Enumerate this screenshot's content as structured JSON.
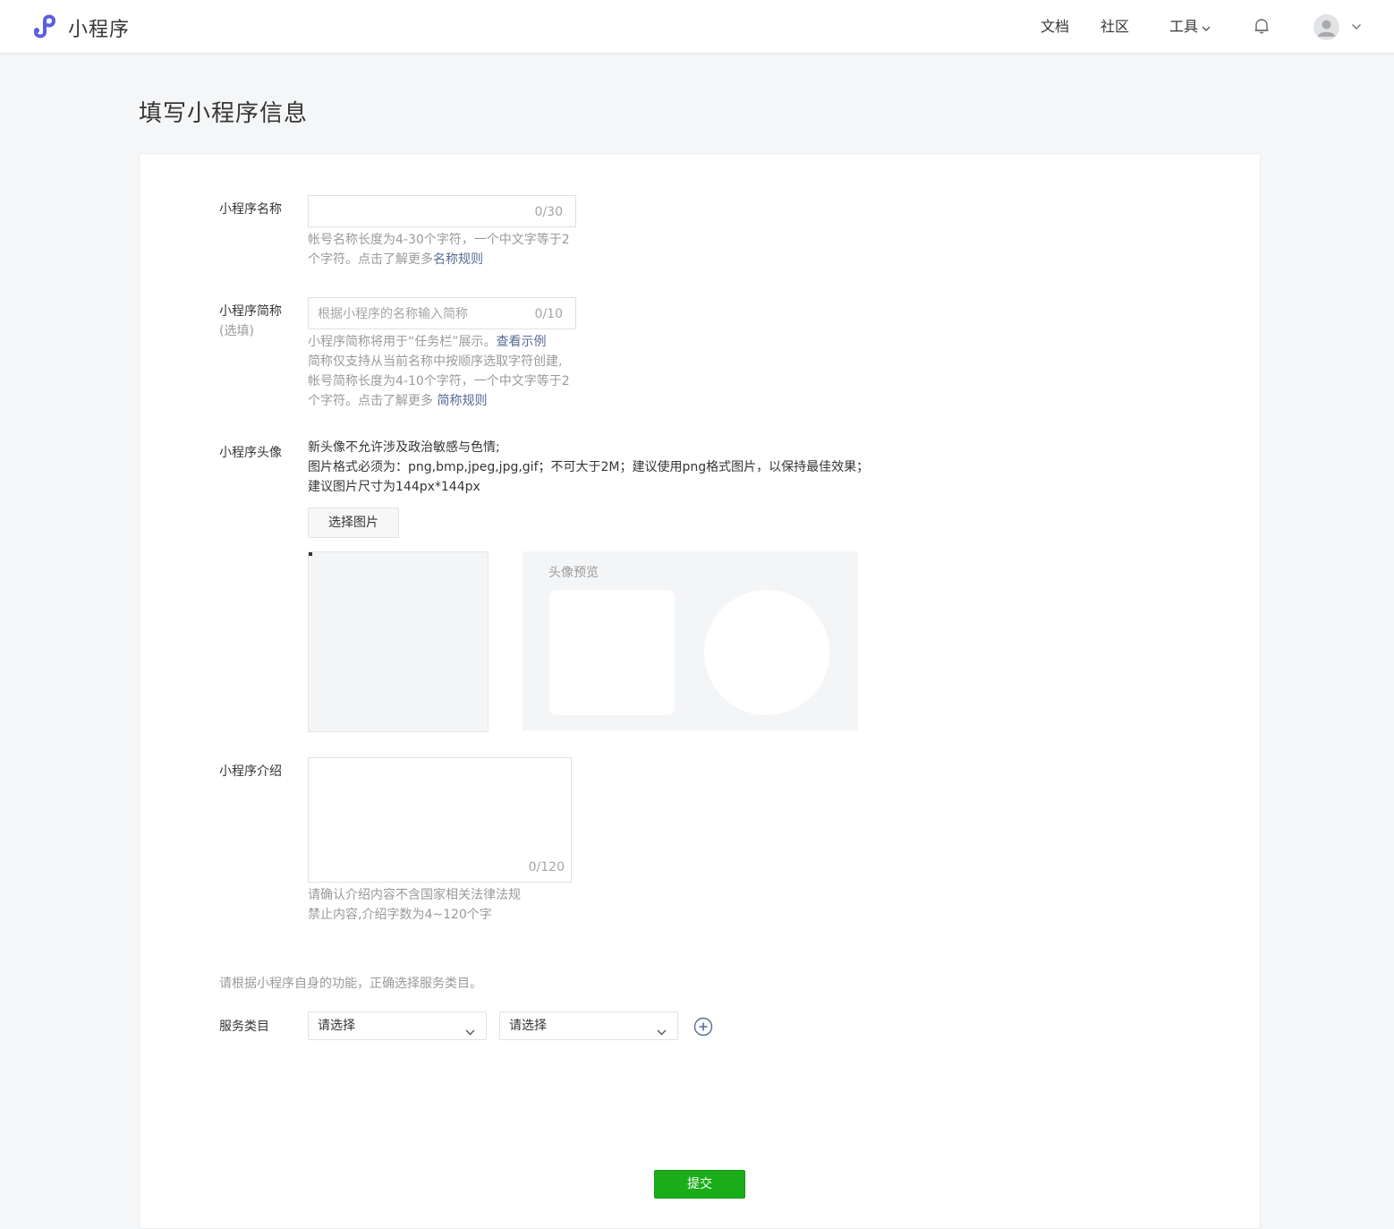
{
  "header": {
    "app_name": "小程序",
    "logo_icon": "mini-program-logo-icon",
    "nav": {
      "docs": "文档",
      "community": "社区",
      "tools": "工具"
    },
    "bell_icon": "bell-icon",
    "avatar_icon": "user-avatar-icon"
  },
  "page": {
    "title": "填写小程序信息"
  },
  "form": {
    "name": {
      "label": "小程序名称",
      "value": "",
      "counter": "0/30",
      "hint_text": "帐号名称长度为4-30个字符，一个中文字等于2个字符。点击了解更多",
      "hint_link": "名称规则"
    },
    "short_name": {
      "label": "小程序简称",
      "optional": "(选填)",
      "placeholder": "根据小程序的名称输入简称",
      "counter": "0/10",
      "hint_line1": "小程序简称将用于“任务栏”展示。",
      "hint_line1_link": "查看示例",
      "hint_line2": "简称仅支持从当前名称中按顺序选取字符创建,",
      "hint_line3": "帐号简称长度为4-10个字符，一个中文字等于2",
      "hint_line4": "个字符。点击了解更多 ",
      "hint_link": "简称规则"
    },
    "avatar": {
      "label": "小程序头像",
      "rule_line1": "新头像不允许涉及政治敏感与色情;",
      "rule_line2": "图片格式必须为：png,bmp,jpeg,jpg,gif；不可大于2M；建议使用png格式图片，以保持最佳效果；",
      "rule_line3": "建议图片尺寸为144px*144px",
      "choose_button": "选择图片",
      "preview_title": "头像预览"
    },
    "intro": {
      "label": "小程序介绍",
      "value": "",
      "counter": "0/120",
      "hint_line1": "请确认介绍内容不含国家相关法律法规",
      "hint_line2": "禁止内容,介绍字数为4~120个字"
    },
    "category": {
      "notice": "请根据小程序自身的功能，正确选择服务类目。",
      "label": "服务类目",
      "select1": "请选择",
      "select2": "请选择",
      "add_icon": "plus-circle-icon"
    },
    "submit": "提交"
  },
  "colors": {
    "accent_green": "#1aad19",
    "link_blue": "#576b95",
    "logo_purple": "#5a5fe0"
  }
}
